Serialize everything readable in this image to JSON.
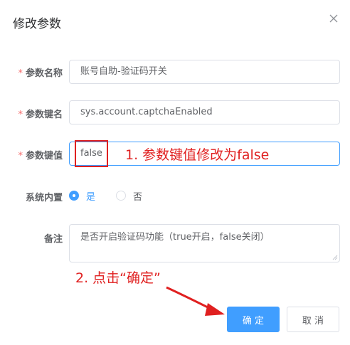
{
  "dialog": {
    "title": "修改参数",
    "close_icon": "close-icon"
  },
  "form": {
    "fields": [
      {
        "label": "参数名称",
        "required": "*",
        "value": "账号自助-验证码开关"
      },
      {
        "label": "参数键名",
        "required": "*",
        "value": "sys.account.captchaEnabled"
      },
      {
        "label": "参数键值",
        "required": "*",
        "value": "false"
      }
    ],
    "builtin": {
      "label": "系统内置",
      "options": [
        {
          "label": "是",
          "checked": true
        },
        {
          "label": "否",
          "checked": false
        }
      ]
    },
    "remark": {
      "label": "备注",
      "value": "是否开启验证码功能（true开启，false关闭）"
    }
  },
  "buttons": {
    "confirm": "确 定",
    "cancel": "取 消"
  },
  "annotations": {
    "step1": "1. 参数键值修改为false",
    "step2": "2. 点击“确定”"
  },
  "colors": {
    "primary": "#409eff",
    "annotation": "#e02020",
    "required": "#f56c6c"
  }
}
